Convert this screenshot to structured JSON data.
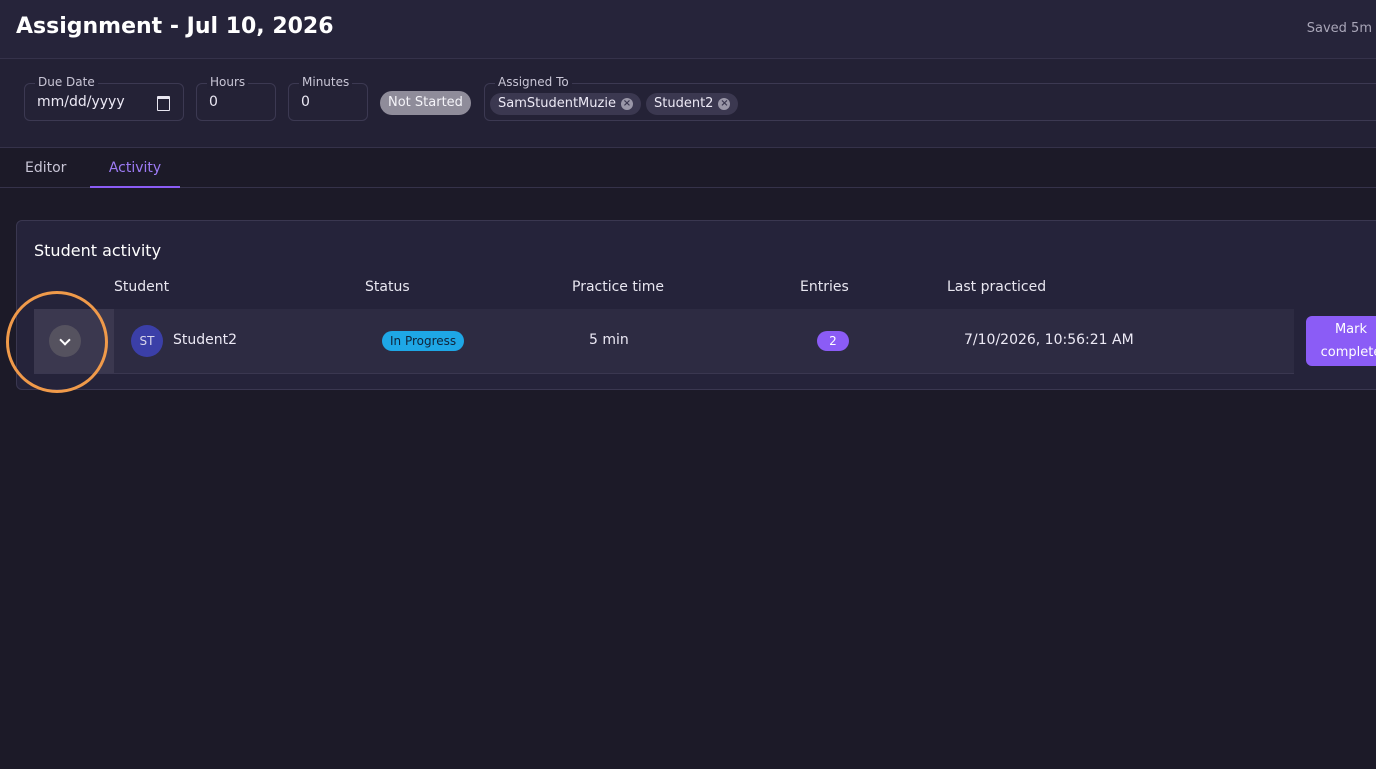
{
  "header": {
    "title": "Assignment - Jul 10, 2026",
    "saved_text": "Saved 5m"
  },
  "toolbar": {
    "due_date": {
      "label": "Due Date",
      "value": "mm/dd/yyyy"
    },
    "hours": {
      "label": "Hours",
      "value": "0"
    },
    "minutes": {
      "label": "Minutes",
      "value": "0"
    },
    "status": "Not Started",
    "assigned_to": {
      "label": "Assigned To",
      "chips": [
        "SamStudentMuzie",
        "Student2"
      ]
    }
  },
  "tabs": [
    {
      "label": "Editor",
      "active": false
    },
    {
      "label": "Activity",
      "active": true
    }
  ],
  "activity": {
    "title": "Student activity",
    "columns": [
      "Student",
      "Status",
      "Practice time",
      "Entries",
      "Last practiced"
    ],
    "rows": [
      {
        "avatar": "ST",
        "student": "Student2",
        "status": "In Progress",
        "practice_time": "5 min",
        "entries": "2",
        "last_practiced": "7/10/2026, 10:56:21 AM",
        "action": "Mark complete"
      }
    ]
  },
  "icons": {
    "calendar": "calendar-icon",
    "expand": "chevron-down-icon",
    "chip_remove": "close-circle-icon"
  },
  "colors": {
    "accent": "#8b5cf6",
    "in_progress": "#1ea7e6",
    "not_started": "#8f8c9a",
    "highlight": "#f09a4a"
  }
}
